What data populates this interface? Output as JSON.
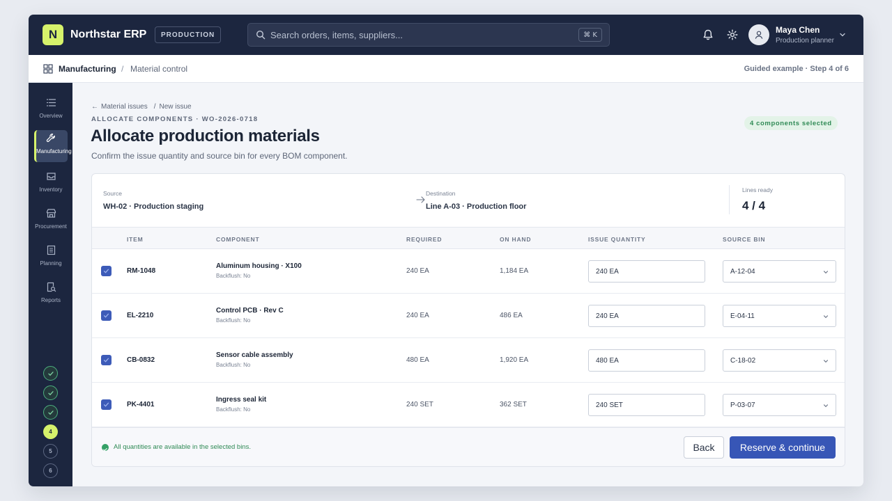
{
  "app": {
    "logo_letter": "N",
    "name": "Northstar ERP",
    "environment": "PRODUCTION",
    "search_placeholder": "Search orders, items, suppliers...",
    "search_shortcut": "⌘ K",
    "user": {
      "name": "Maya Chen",
      "role": "Production planner"
    }
  },
  "breadcrumb": {
    "section": "Manufacturing",
    "separator": "/",
    "page": "Material control",
    "step_info": "Guided example · Step 4 of 6"
  },
  "sidebar": {
    "items": [
      {
        "label": "Overview",
        "icon": "list-icon"
      },
      {
        "label": "Manufacturing",
        "icon": "wrench-icon",
        "active": true
      },
      {
        "label": "Inventory",
        "icon": "inbox-icon"
      },
      {
        "label": "Procurement",
        "icon": "store-icon"
      },
      {
        "label": "Planning",
        "icon": "document-icon"
      },
      {
        "label": "Reports",
        "icon": "report-search-icon"
      }
    ],
    "steps": [
      {
        "label": "",
        "status": "done"
      },
      {
        "label": "",
        "status": "done"
      },
      {
        "label": "",
        "status": "done"
      },
      {
        "label": "4",
        "status": "current"
      },
      {
        "label": "5",
        "status": "todo"
      },
      {
        "label": "6",
        "status": "todo"
      }
    ]
  },
  "page": {
    "back_link": "Material issues",
    "back_sep": "/",
    "back_current": "New issue",
    "eyebrow": "ALLOCATE COMPONENTS · WO-2026-0718",
    "title": "Allocate production materials",
    "subtitle": "Confirm the issue quantity and source bin for every BOM component.",
    "selection_badge": "4 components selected"
  },
  "route": {
    "source_label": "Source",
    "source_value": "WH-02 · Production staging",
    "destination_label": "Destination",
    "destination_value": "Line A-03 · Production floor",
    "ready_label": "Lines ready",
    "ready_value": "4 / 4"
  },
  "table": {
    "headers": {
      "item": "ITEM",
      "component": "COMPONENT",
      "required": "REQUIRED",
      "on_hand": "ON HAND",
      "issue_quantity": "ISSUE QUANTITY",
      "source_bin": "SOURCE BIN"
    },
    "rows": [
      {
        "item": "RM-1048",
        "component": "Aluminum housing · X100",
        "meta": "Backflush: No",
        "required": "240 EA",
        "on_hand": "1,184 EA",
        "issue_qty": "240 EA",
        "bin": "A-12-04",
        "checked": true
      },
      {
        "item": "EL-2210",
        "component": "Control PCB · Rev C",
        "meta": "Backflush: No",
        "required": "240 EA",
        "on_hand": "486 EA",
        "issue_qty": "240 EA",
        "bin": "E-04-11",
        "checked": true
      },
      {
        "item": "CB-0832",
        "component": "Sensor cable assembly",
        "meta": "Backflush: No",
        "required": "480 EA",
        "on_hand": "1,920 EA",
        "issue_qty": "480 EA",
        "bin": "C-18-02",
        "checked": true
      },
      {
        "item": "PK-4401",
        "component": "Ingress seal kit",
        "meta": "Backflush: No",
        "required": "240 SET",
        "on_hand": "362 SET",
        "issue_qty": "240 SET",
        "bin": "P-03-07",
        "checked": true
      }
    ]
  },
  "footer": {
    "status": "All quantities are available in the selected bins.",
    "back_label": "Back",
    "primary_label": "Reserve & continue"
  },
  "colors": {
    "navy": "#1c263f",
    "accent_lime": "#d6f26b",
    "primary_blue": "#3756b6",
    "success_green": "#2f8a55"
  }
}
